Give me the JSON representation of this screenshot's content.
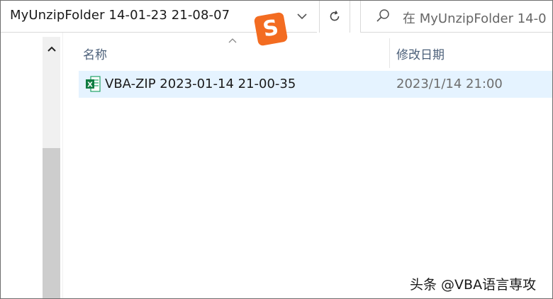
{
  "address_bar": {
    "path": "MyUnzipFolder  14-01-23 21-08-07",
    "dropdown_icon": "chevron-down-icon"
  },
  "toolbar": {
    "refresh_icon": "refresh-icon"
  },
  "search": {
    "placeholder": "在 MyUnzipFolder  14-0",
    "icon": "search-icon"
  },
  "ime": {
    "logo_glyph": "S",
    "color": "#f36c21"
  },
  "columns": {
    "name_label": "名称",
    "date_label": "修改日期",
    "header_color": "#4c607a"
  },
  "files": [
    {
      "name": "VBA-ZIP 2023-01-14 21-00-35",
      "modified": "2023/1/14 21:00",
      "icon": "excel-file-icon",
      "selected_hover_color": "#e5f3ff"
    }
  ],
  "watermark": {
    "text": "头条 @VBA语言専攻"
  }
}
